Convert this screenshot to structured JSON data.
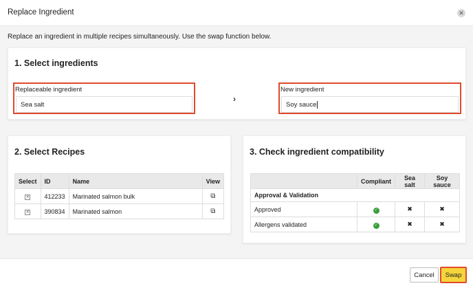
{
  "dialog": {
    "title": "Replace Ingredient",
    "close_icon": "close-icon",
    "instructions": "Replace an ingredient in multiple recipes simultaneously. Use the swap function below."
  },
  "select_ingredients": {
    "heading": "1. Select ingredients",
    "replaceable": {
      "label": "Replaceable ingredient",
      "value": "Sea salt"
    },
    "arrow_icon": "chevron-right-icon",
    "new": {
      "label": "New ingredient",
      "value": "Soy sauce"
    }
  },
  "select_recipes": {
    "heading": "2. Select Recipes",
    "columns": [
      "Select",
      "ID",
      "Name",
      "View"
    ],
    "rows": [
      {
        "id": "412233",
        "name": "Marinated salmon bulk"
      },
      {
        "id": "390834",
        "name": "Marinated salmon"
      }
    ]
  },
  "compatibility": {
    "heading": "3. Check ingredient compatibility",
    "columns": [
      "",
      "Compliant",
      "Sea salt",
      "Soy sauce"
    ],
    "group": "Approval & Validation",
    "rows": [
      {
        "label": "Approved"
      },
      {
        "label": "Allergens validated"
      }
    ]
  },
  "footer": {
    "cancel": "Cancel",
    "swap": "Swap"
  },
  "colors": {
    "highlight_border": "#e04a2a",
    "swap_button": "#f5d53c",
    "check_green": "#3a9d3a"
  }
}
